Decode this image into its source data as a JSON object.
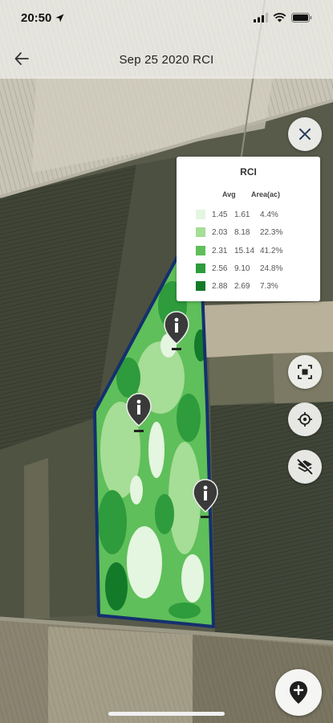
{
  "status": {
    "time": "20:50",
    "icons": [
      "location-arrow-icon",
      "signal-icon",
      "wifi-icon",
      "battery-icon"
    ]
  },
  "header": {
    "title": "Sep 25 2020 RCI",
    "back_icon": "back-arrow-icon"
  },
  "legend": {
    "title": "RCI",
    "col_avg": "Avg",
    "col_area": "Area(ac)",
    "rows": [
      {
        "color": "#e4f5e0",
        "avg": "1.45",
        "area": "1.61",
        "pct": "4.4%"
      },
      {
        "color": "#a6dd97",
        "avg": "2.03",
        "area": "8.18",
        "pct": "22.3%"
      },
      {
        "color": "#5fbf5a",
        "avg": "2.31",
        "area": "15.14",
        "pct": "41.2%"
      },
      {
        "color": "#2e9b3c",
        "avg": "2.56",
        "area": "9.10",
        "pct": "24.8%"
      },
      {
        "color": "#137a2a",
        "avg": "2.88",
        "area": "2.69",
        "pct": "7.3%"
      }
    ]
  },
  "controls": [
    "close-icon",
    "fit-bounds-icon",
    "my-location-icon",
    "hide-layers-icon",
    "add-pin-icon"
  ],
  "markers": [
    "info-marker",
    "info-marker",
    "info-marker"
  ],
  "colors": {
    "field_outline": "#14306e",
    "accent": "#1f1f1f"
  }
}
